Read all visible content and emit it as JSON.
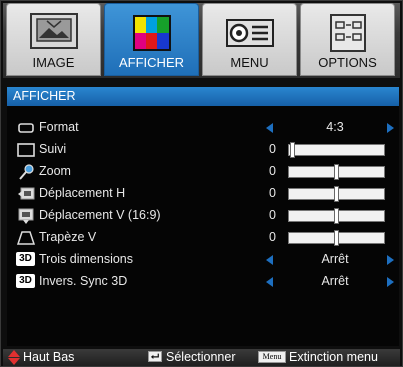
{
  "tabs": [
    {
      "label": "IMAGE",
      "active": false
    },
    {
      "label": "AFFICHER",
      "active": true
    },
    {
      "label": "MENU",
      "active": false
    },
    {
      "label": "OPTIONS",
      "active": false
    }
  ],
  "section_title": "AFFICHER",
  "rows": [
    {
      "label": "Format",
      "icon": "aspect-ratio-icon",
      "kind": "choice",
      "value": "4:3"
    },
    {
      "label": "Suivi",
      "icon": "screen-icon",
      "kind": "slider",
      "value": "0",
      "level": 0.0
    },
    {
      "label": "Zoom",
      "icon": "magnifier-icon",
      "kind": "slider",
      "value": "0",
      "level": 0.5
    },
    {
      "label": "Déplacement H",
      "icon": "horizontal-shift-icon",
      "kind": "slider",
      "value": "0",
      "level": 0.5
    },
    {
      "label": "Déplacement V (16:9)",
      "icon": "vertical-shift-icon",
      "kind": "slider",
      "value": "0",
      "level": 0.5
    },
    {
      "label": "Trapèze V",
      "icon": "keystone-icon",
      "kind": "slider",
      "value": "0",
      "level": 0.5
    },
    {
      "label": "Trois dimensions",
      "icon": "3d-icon",
      "badge": "3D",
      "kind": "choice",
      "value": "Arrêt"
    },
    {
      "label": "Invers. Sync 3D",
      "icon": "3d-icon",
      "badge": "3D",
      "kind": "choice",
      "value": "Arrêt"
    }
  ],
  "footer": {
    "nav_label": "Haut Bas",
    "select_label": "Sélectionner",
    "menu_key": "Menu",
    "exit_label": "Extinction menu"
  },
  "colors": {
    "accent": "#1f6fb8",
    "arrow": "#1d6fc0",
    "nav_arrow": "#e03030"
  }
}
